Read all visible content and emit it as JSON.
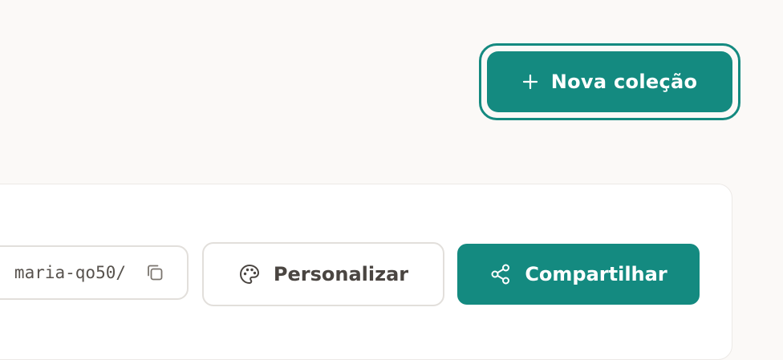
{
  "header": {
    "new_collection_label": "Nova coleção",
    "new_collection_icon": "plus-icon"
  },
  "share_panel": {
    "link_text": "maria-qo50/",
    "copy_icon": "copy-icon",
    "personalize_label": "Personalizar",
    "personalize_icon": "palette-icon",
    "share_label": "Compartilhar",
    "share_icon": "share-icon"
  },
  "colors": {
    "background": "#fbf9f7",
    "accent": "#148a80",
    "card": "#ffffff",
    "border": "#e2dfdb",
    "text": "#4a4541"
  }
}
